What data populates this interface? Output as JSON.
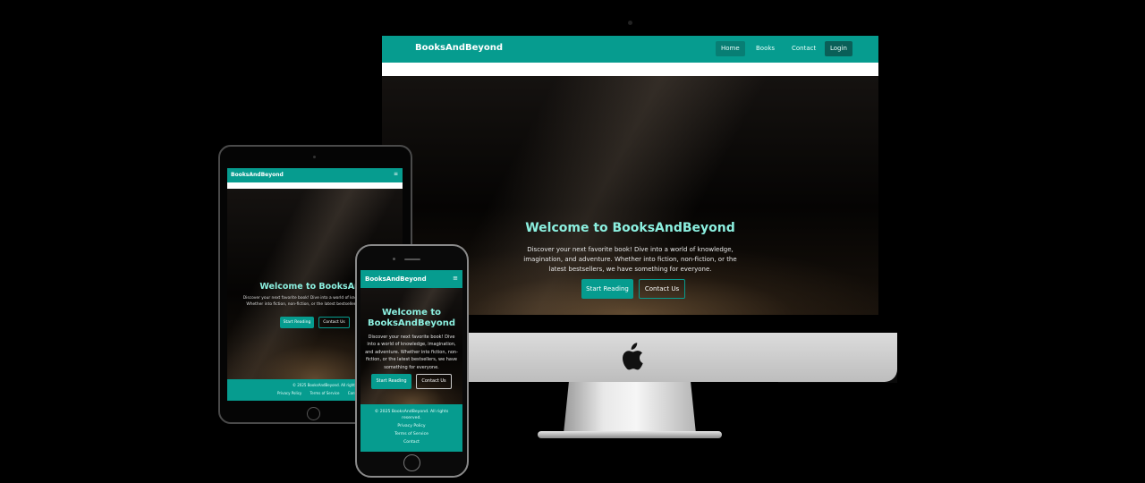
{
  "brand": "BooksAndBeyond",
  "colors": {
    "primary": "#069c8f",
    "accent_text": "#8cf0e0",
    "background": "#000000"
  },
  "desktop": {
    "nav": [
      {
        "label": "Home",
        "active": true
      },
      {
        "label": "Books"
      },
      {
        "label": "Contact"
      },
      {
        "label": "Login"
      }
    ],
    "hero_title": "Welcome to BooksAndBeyond",
    "hero_text": "Discover your next favorite book! Dive into a world of knowledge, imagination, and adventure. Whether into fiction, non-fiction, or the latest bestsellers, we have something for everyone.",
    "primary_button": "Start Reading",
    "secondary_button": "Contact Us",
    "apple_icon": "apple-logo-icon"
  },
  "tablet": {
    "menu_icon": "≡",
    "hero_title": "Welcome to BooksAndBeyond",
    "hero_text": "Discover your next favorite book! Dive into a world of knowledge, imagination, and adventure. Whether into fiction, non-fiction, or the latest bestsellers, we have something for everyone.",
    "primary_button": "Start Reading",
    "secondary_button": "Contact Us",
    "footer_copyright": "© 2025 BooksAndBeyond. All rights reserved.",
    "footer_links": [
      "Privacy Policy",
      "Terms of Service",
      "Contact"
    ]
  },
  "phone": {
    "menu_icon": "≡",
    "hero_title": "Welcome to BooksAndBeyond",
    "hero_text": "Discover your next favorite book! Dive into a world of knowledge, imagination, and adventure. Whether into fiction, non-fiction, or the latest bestsellers, we have something for everyone.",
    "primary_button": "Start Reading",
    "secondary_button": "Contact Us",
    "footer_copyright": "© 2025 BooksAndBeyond. All rights reserved.",
    "footer_links": [
      "Privacy Policy",
      "Terms of Service",
      "Contact"
    ]
  }
}
